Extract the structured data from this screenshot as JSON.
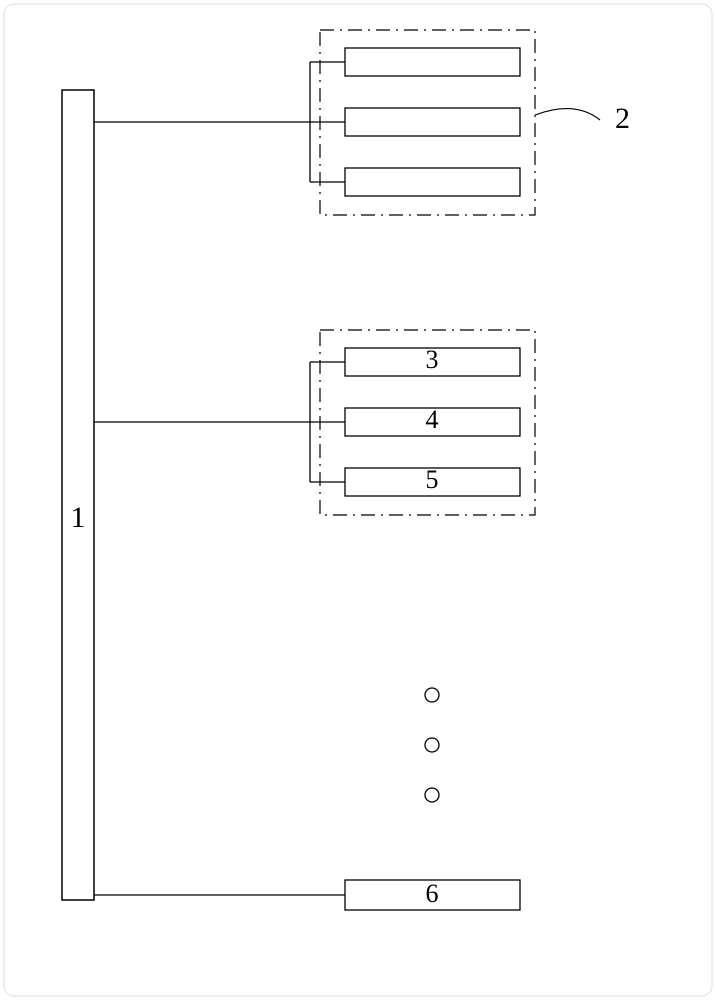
{
  "labels": {
    "main_block": "1",
    "group_top_callout": "2",
    "mid_sub1": "3",
    "mid_sub2": "4",
    "mid_sub3": "5",
    "bottom_block": "6"
  },
  "chart_data": {
    "type": "block-diagram",
    "description": "A tall main block (1) on the left connects via horizontal bus lines to three groups on the right. Top group (2) is a dash-dot container holding three unlabeled sub-blocks branched from a single bus. Middle group is a dash-dot container with three sub-blocks labeled 3, 4, 5 branched similarly. Vertical ellipsis (three small circles) indicates more groups omitted. Bottom block (6) connects directly via a single line.",
    "nodes": [
      {
        "id": "1",
        "role": "main"
      },
      {
        "id": "2",
        "role": "group-container",
        "children": [
          "g2a",
          "g2b",
          "g2c"
        ]
      },
      {
        "id": "g2a",
        "role": "sub-block",
        "label": ""
      },
      {
        "id": "g2b",
        "role": "sub-block",
        "label": ""
      },
      {
        "id": "g2c",
        "role": "sub-block",
        "label": ""
      },
      {
        "id": "gmid",
        "role": "group-container",
        "children": [
          "3",
          "4",
          "5"
        ]
      },
      {
        "id": "3",
        "role": "sub-block"
      },
      {
        "id": "4",
        "role": "sub-block"
      },
      {
        "id": "5",
        "role": "sub-block"
      },
      {
        "id": "6",
        "role": "sub-block"
      }
    ],
    "edges": [
      {
        "from": "1",
        "to": "2"
      },
      {
        "from": "1",
        "to": "gmid"
      },
      {
        "from": "1",
        "to": "6"
      }
    ],
    "ellipsis": true
  }
}
